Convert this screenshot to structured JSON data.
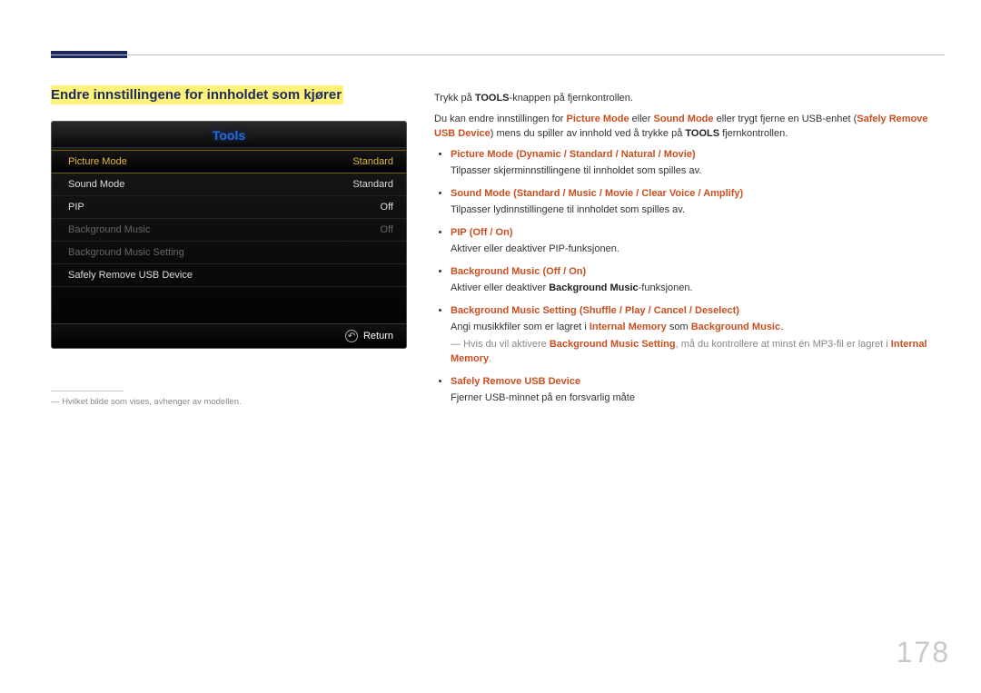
{
  "section_title": "Endre innstillingene for innholdet som kjører",
  "tv": {
    "title": "Tools",
    "rows": [
      {
        "label": "Picture Mode",
        "value": "Standard",
        "state": "sel"
      },
      {
        "label": "Sound Mode",
        "value": "Standard",
        "state": ""
      },
      {
        "label": "PIP",
        "value": "Off",
        "state": ""
      },
      {
        "label": "Background Music",
        "value": "Off",
        "state": "dim"
      },
      {
        "label": "Background Music Setting",
        "value": "",
        "state": "dim"
      },
      {
        "label": "Safely Remove USB Device",
        "value": "",
        "state": ""
      }
    ],
    "return_label": "Return"
  },
  "footnote": "Hvilket bilde som vises, avhenger av modellen.",
  "intro": {
    "p1a": "Trykk på ",
    "p1b": "TOOLS",
    "p1c": "-knappen på fjernkontrollen.",
    "p2a": "Du kan endre innstillingen for ",
    "p2_pm": "Picture Mode",
    "p2b": " eller ",
    "p2_sm": "Sound Mode",
    "p2c": " eller trygt fjerne en USB-enhet (",
    "p2_sr": "Safely Remove USB Device",
    "p2d": ") mens du spiller av innhold ved å trykke på ",
    "p2_tools": "TOOLS",
    "p2e": " fjernkontrollen."
  },
  "items": {
    "pm": {
      "name": "Picture Mode",
      "opts": [
        "Dynamic",
        "Standard",
        "Natural",
        "Movie"
      ],
      "desc": "Tilpasser skjerminnstillingene til innholdet som spilles av."
    },
    "sm": {
      "name": "Sound Mode",
      "opts": [
        "Standard",
        "Music",
        "Movie",
        "Clear Voice",
        "Amplify"
      ],
      "desc": "Tilpasser lydinnstillingene til innholdet som spilles av."
    },
    "pip": {
      "name": "PIP",
      "opts": [
        "Off",
        "On"
      ],
      "desc": "Aktiver eller deaktiver PIP-funksjonen."
    },
    "bgm": {
      "name": "Background Music",
      "opts": [
        "Off",
        "On"
      ],
      "desc_a": "Aktiver eller deaktiver ",
      "desc_b": "Background Music",
      "desc_c": "-funksjonen."
    },
    "bgms": {
      "name": "Background Music Setting",
      "opts": [
        "Shuffle",
        "Play",
        "Cancel",
        "Deselect"
      ],
      "desc_a": "Angi musikkfiler som er lagret i ",
      "desc_im": "Internal Memory",
      "desc_b": " som ",
      "desc_bm": "Background Music",
      "desc_c": ".",
      "note_a": "Hvis du vil aktivere ",
      "note_bgms": "Background Music Setting",
      "note_b": ", må du kontrollere at minst én MP3-fil er lagret i ",
      "note_im": "Internal Memory",
      "note_c": "."
    },
    "sr": {
      "name": "Safely Remove USB Device",
      "desc": "Fjerner USB-minnet på en forsvarlig måte"
    }
  },
  "sep": " / ",
  "lp": "(",
  "rp": ")",
  "page_number": "178"
}
